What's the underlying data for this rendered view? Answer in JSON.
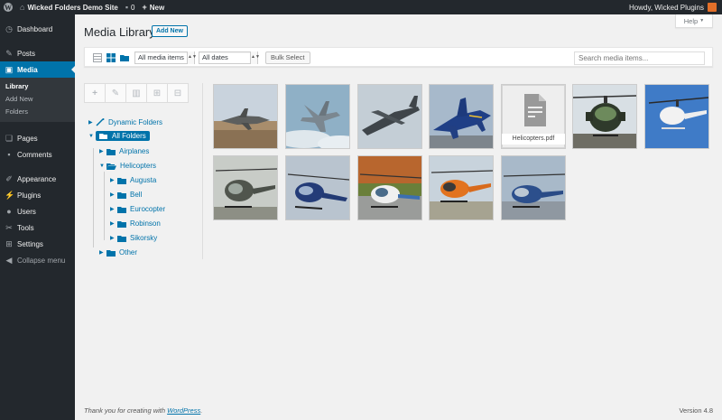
{
  "admin_bar": {
    "site_name": "Wicked Folders Demo Site",
    "comments_count": "0",
    "new_label": "New",
    "howdy": "Howdy, Wicked Plugins"
  },
  "sidebar": {
    "items": [
      {
        "label": "Dashboard",
        "icon": "dashboard-icon"
      },
      {
        "label": "Posts",
        "icon": "pin-icon"
      },
      {
        "label": "Media",
        "icon": "media-icon"
      },
      {
        "label": "Pages",
        "icon": "pages-icon"
      },
      {
        "label": "Comments",
        "icon": "comments-icon"
      },
      {
        "label": "Appearance",
        "icon": "brush-icon"
      },
      {
        "label": "Plugins",
        "icon": "plugin-icon"
      },
      {
        "label": "Users",
        "icon": "users-icon"
      },
      {
        "label": "Tools",
        "icon": "wrench-icon"
      },
      {
        "label": "Settings",
        "icon": "settings-icon"
      },
      {
        "label": "Collapse menu",
        "icon": "collapse-icon"
      }
    ],
    "media_submenu": [
      "Library",
      "Add New",
      "Folders"
    ]
  },
  "header": {
    "help_label": "Help",
    "title": "Media Library",
    "add_new_label": "Add New"
  },
  "toolbar": {
    "media_filter": "All media items",
    "date_filter": "All dates",
    "bulk_select_label": "Bulk Select",
    "search_placeholder": "Search media items..."
  },
  "folders": {
    "dynamic": "Dynamic Folders",
    "all": "All Folders",
    "airplanes": "Airplanes",
    "helicopters": "Helicopters",
    "augusta": "Augusta",
    "bell": "Bell",
    "eurocopter": "Eurocopter",
    "robinson": "Robinson",
    "sikorsky": "Sikorsky",
    "other": "Other"
  },
  "media": {
    "items": [
      {
        "kind": "image",
        "subject": "jet-fighter-desert"
      },
      {
        "kind": "image",
        "subject": "jet-fighter-clouds"
      },
      {
        "kind": "image",
        "subject": "cargo-plane"
      },
      {
        "kind": "image",
        "subject": "jet-fighter-blue"
      },
      {
        "kind": "document",
        "filename": "Helicopters.pdf"
      },
      {
        "kind": "image",
        "subject": "helicopter-front"
      },
      {
        "kind": "image",
        "subject": "helicopter-white-sky"
      },
      {
        "kind": "image",
        "subject": "helicopter-grey"
      },
      {
        "kind": "image",
        "subject": "helicopter-blue"
      },
      {
        "kind": "image",
        "subject": "helicopter-white-ground"
      },
      {
        "kind": "image",
        "subject": "helicopter-orange"
      },
      {
        "kind": "image",
        "subject": "helicopter-blue-ground"
      }
    ]
  },
  "footer": {
    "thanks": "Thank you for creating with ",
    "link": "WordPress",
    "period": ".",
    "version": "Version 4.8"
  },
  "colors": {
    "admin_dark": "#23282d",
    "accent": "#0073aa",
    "background": "#f1f1f1"
  }
}
